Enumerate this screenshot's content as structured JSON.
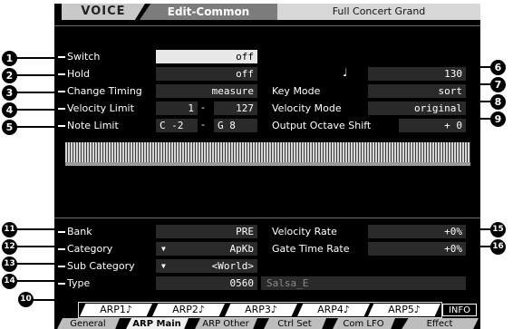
{
  "header": {
    "tab": "VOICE",
    "section": "Edit-Common",
    "voice_name": "Full Concert Grand"
  },
  "params_top": [
    {
      "label": "Switch",
      "value": "off"
    },
    {
      "label": "Hold",
      "value": "off"
    },
    {
      "label": "Change Timing",
      "value": "measure"
    },
    {
      "label": "Velocity Limit",
      "low": "1",
      "sep": "-",
      "high": "127"
    },
    {
      "label": "Note Limit",
      "low": "C -2",
      "sep": "-",
      "high": "G  8"
    }
  ],
  "params_right_top": [
    {
      "label": "♩",
      "value": "130"
    },
    {
      "label": "Key Mode",
      "value": "sort"
    },
    {
      "label": "Velocity Mode",
      "value": "original"
    },
    {
      "label": "Output Octave Shift",
      "value": "+ 0"
    }
  ],
  "params_bottom": [
    {
      "label": "Bank",
      "value": "PRE"
    },
    {
      "label": "Category",
      "value": "ApKb"
    },
    {
      "label": "Sub Category",
      "value": "<World>"
    },
    {
      "label": "Type",
      "value": "0560",
      "name": "Salsa_E"
    }
  ],
  "params_right_bottom": [
    {
      "label": "Velocity Rate",
      "value": "+0%"
    },
    {
      "label": "Gate Time Rate",
      "value": "+0%"
    }
  ],
  "arp_buttons": [
    "ARP1♪",
    "ARP2♪",
    "ARP3♪",
    "ARP4♪",
    "ARP5♪"
  ],
  "info_button": "INFO",
  "bottom_tabs": [
    "General",
    "ARP Main",
    "ARP Other",
    "Ctrl Set",
    "Com LFO",
    "Effect"
  ],
  "callouts": [
    "1",
    "2",
    "3",
    "4",
    "5",
    "6",
    "7",
    "8",
    "9",
    "10",
    "11",
    "12",
    "13",
    "14",
    "15",
    "16"
  ],
  "colors": {
    "screen": "#000000",
    "selected": "#e8e8e8",
    "field": "#2a2a2a"
  }
}
